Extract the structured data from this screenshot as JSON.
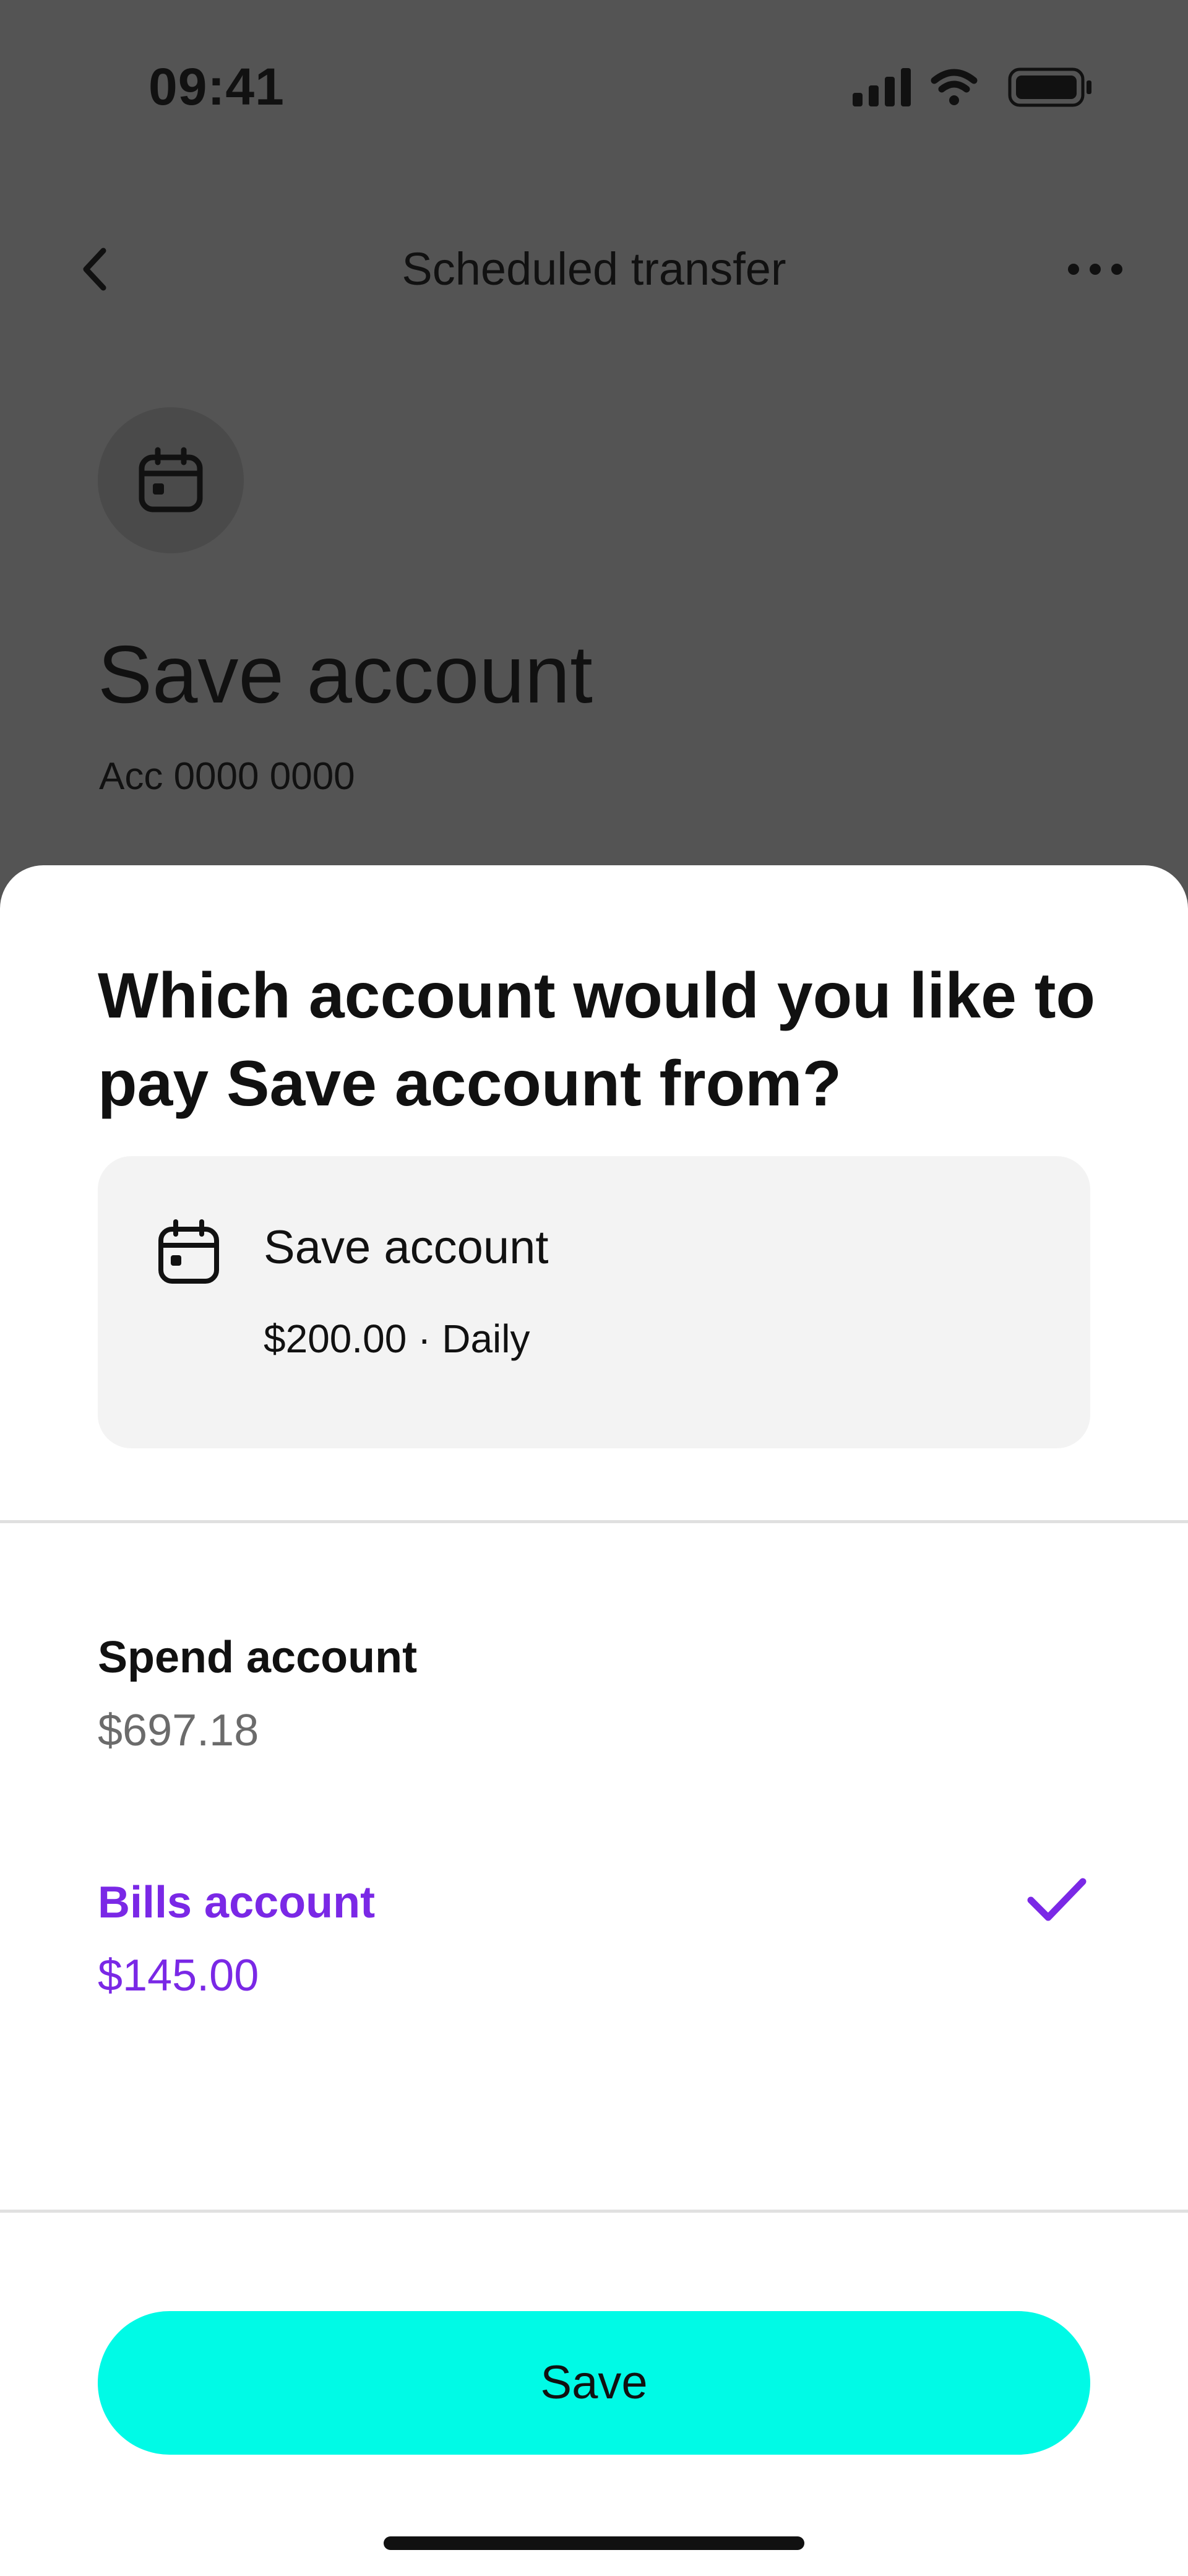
{
  "status_bar": {
    "time": "09:41"
  },
  "nav": {
    "title": "Scheduled transfer",
    "back_icon": "chevron-left-icon",
    "more_icon": "more-horizontal-icon"
  },
  "background": {
    "icon": "calendar-icon",
    "title": "Save account",
    "subtitle": "Acc 0000 0000"
  },
  "sheet": {
    "question": "Which account would you like to pay Save account from?",
    "summary": {
      "icon": "calendar-icon",
      "name": "Save account",
      "detail": "$200.00 · Daily"
    },
    "accounts": [
      {
        "name": "Spend account",
        "balance": "$697.18",
        "selected": false
      },
      {
        "name": "Bills account",
        "balance": "$145.00",
        "selected": true
      }
    ],
    "save_label": "Save"
  },
  "colors": {
    "overlay_bg": "#545454",
    "accent_purple": "#7a28e6",
    "button_cyan": "#00fae6",
    "card_bg": "#f3f3f3",
    "text": "#111111",
    "muted_text": "#6b6b6b"
  }
}
